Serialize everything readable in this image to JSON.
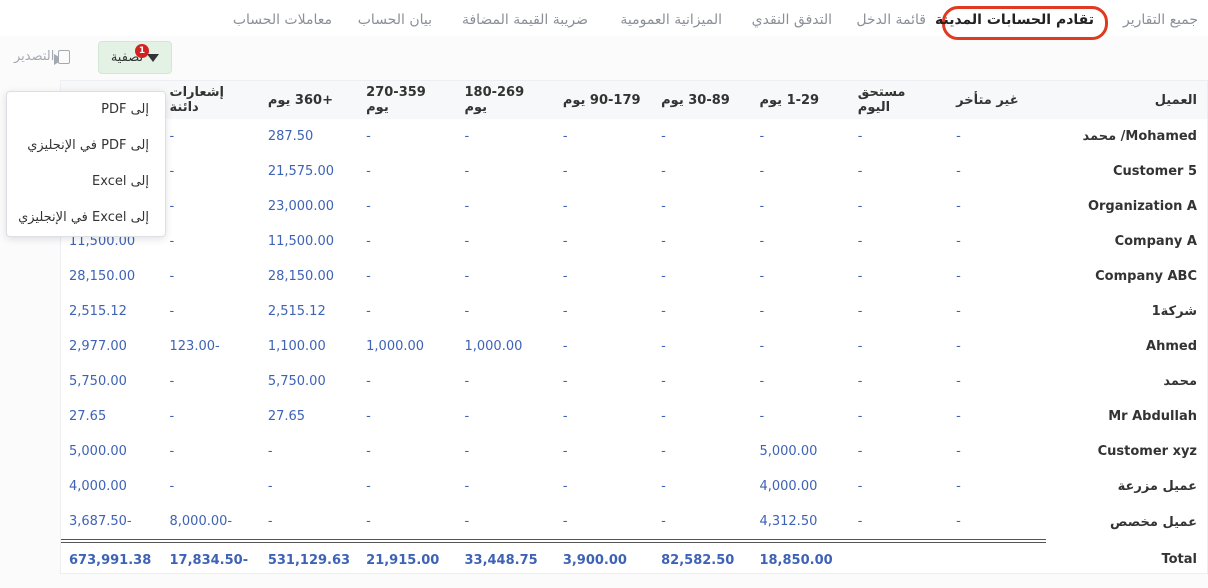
{
  "tabs": [
    "جميع التقارير",
    "تقادم الحسابات المدينة",
    "قائمة الدخل",
    "التدفق النقدي",
    "الميزانية العمومية",
    "ضريبة القيمة المضافة",
    "بيان الحساب",
    "معاملات الحساب"
  ],
  "active_tab": "تقادم الحسابات المدينة",
  "toolbar": {
    "filter_label": "تصفية",
    "filter_count": "1",
    "export_label": "التصدير"
  },
  "dropdown": [
    "إلى PDF",
    "إلى PDF في الإنجليزي",
    "إلى Excel",
    "إلى Excel في الإنجليزي"
  ],
  "columns": [
    "العميل",
    "غير متأخر",
    "مستحق اليوم",
    "1-29 يوم",
    "30-89 يوم",
    "90-179 يوم",
    "180-269 يوم",
    "270-359 يوم",
    "+360 يوم",
    "إشعارات دائنة",
    ""
  ],
  "rows": [
    [
      "Mohamed/ محمد",
      "-",
      "-",
      "-",
      "-",
      "-",
      "-",
      "-",
      "287.50",
      "-",
      ""
    ],
    [
      "Customer 5",
      "-",
      "-",
      "-",
      "-",
      "-",
      "-",
      "-",
      "21,575.00",
      "-",
      ""
    ],
    [
      "Organization A",
      "-",
      "-",
      "-",
      "-",
      "-",
      "-",
      "-",
      "23,000.00",
      "-",
      ""
    ],
    [
      "Company A",
      "-",
      "-",
      "-",
      "-",
      "-",
      "-",
      "-",
      "11,500.00",
      "-",
      "11,500.00"
    ],
    [
      "Company ABC",
      "-",
      "-",
      "-",
      "-",
      "-",
      "-",
      "-",
      "28,150.00",
      "-",
      "28,150.00"
    ],
    [
      "شركة1",
      "-",
      "-",
      "-",
      "-",
      "-",
      "-",
      "-",
      "2,515.12",
      "-",
      "2,515.12"
    ],
    [
      "Ahmed",
      "-",
      "-",
      "-",
      "-",
      "-",
      "1,000.00",
      "1,000.00",
      "1,100.00",
      "-123.00",
      "2,977.00"
    ],
    [
      "محمد",
      "-",
      "-",
      "-",
      "-",
      "-",
      "-",
      "-",
      "5,750.00",
      "-",
      "5,750.00"
    ],
    [
      "Mr Abdullah",
      "-",
      "-",
      "-",
      "-",
      "-",
      "-",
      "-",
      "27.65",
      "-",
      "27.65"
    ],
    [
      "Customer xyz",
      "-",
      "-",
      "5,000.00",
      "-",
      "-",
      "-",
      "-",
      "-",
      "-",
      "5,000.00"
    ],
    [
      "عميل مزرعة",
      "-",
      "-",
      "4,000.00",
      "-",
      "-",
      "-",
      "-",
      "-",
      "-",
      "4,000.00"
    ],
    [
      "عميل مخصص",
      "-",
      "-",
      "4,312.50",
      "-",
      "-",
      "-",
      "-",
      "-",
      "-8,000.00",
      "-3,687.50"
    ]
  ],
  "total": [
    "Total",
    "",
    "",
    "18,850.00",
    "82,582.50",
    "3,900.00",
    "33,448.75",
    "21,915.00",
    "531,129.63",
    "-17,834.50",
    "673,991.38"
  ]
}
